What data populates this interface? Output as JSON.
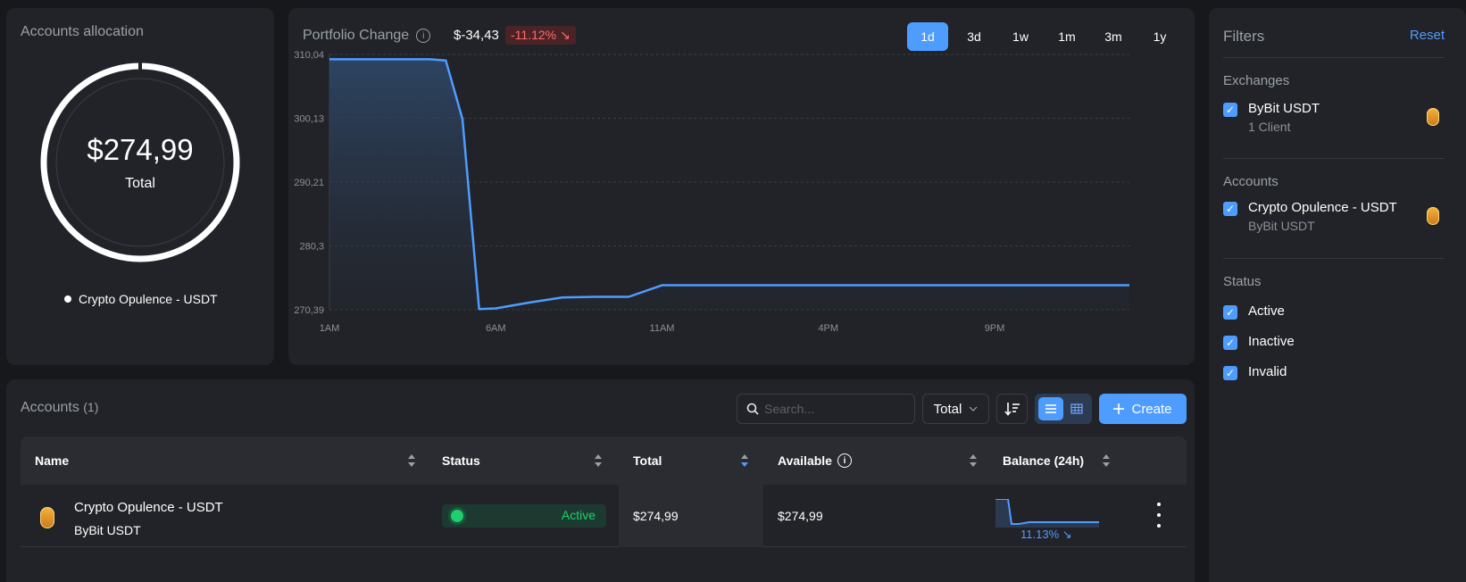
{
  "allocation": {
    "title": "Accounts allocation",
    "total_value": "$274,99",
    "total_label": "Total",
    "legend_item": "Crypto Opulence - USDT"
  },
  "portfolio": {
    "title": "Portfolio Change",
    "change_value": "$-34,43",
    "change_pct": "-11.12%",
    "ranges": [
      "1d",
      "3d",
      "1w",
      "1m",
      "3m",
      "1y"
    ],
    "active_range": "1d"
  },
  "chart_data": {
    "type": "area",
    "title": "",
    "xlabel": "",
    "ylabel": "",
    "y_ticks": [
      "310,04",
      "300,13",
      "290,21",
      "280,3",
      "270,39"
    ],
    "x_ticks": [
      "1AM",
      "6AM",
      "11AM",
      "4PM",
      "9PM"
    ],
    "ylim": [
      270.39,
      310.04
    ],
    "series": [
      {
        "x": [
          "1AM",
          "2AM",
          "3AM",
          "4AM",
          "4:30AM",
          "5AM",
          "5:30AM",
          "6AM",
          "7AM",
          "8AM",
          "9AM",
          "10AM",
          "11AM",
          "1PM",
          "3PM",
          "5PM",
          "7PM",
          "9PM",
          "11PM",
          "12AM"
        ],
        "values": [
          309.3,
          309.3,
          309.3,
          309.3,
          309.1,
          300.0,
          270.5,
          270.6,
          271.5,
          272.3,
          272.4,
          272.4,
          274.2,
          274.2,
          274.2,
          274.2,
          274.2,
          274.2,
          274.2,
          274.2
        ]
      }
    ],
    "grid": true
  },
  "filters": {
    "title": "Filters",
    "reset_label": "Reset",
    "exchanges_label": "Exchanges",
    "exchange_items": [
      {
        "title": "ByBit USDT",
        "subtitle": "1 Client"
      }
    ],
    "accounts_label": "Accounts",
    "account_items": [
      {
        "title": "Crypto Opulence - USDT",
        "subtitle": "ByBit USDT"
      }
    ],
    "status_label": "Status",
    "status_items": [
      "Active",
      "Inactive",
      "Invalid"
    ]
  },
  "accounts": {
    "title": "Accounts",
    "count": "(1)",
    "search_placeholder": "Search...",
    "select_value": "Total",
    "create_label": "Create",
    "columns": [
      "Name",
      "Status",
      "Total",
      "Available",
      "Balance (24h)"
    ],
    "rows": [
      {
        "name": "Crypto Opulence - USDT",
        "exchange": "ByBit USDT",
        "status": "Active",
        "total": "$274,99",
        "available": "$274,99",
        "balance_pct": "11.13%"
      }
    ]
  },
  "colors": {
    "accent": "#4f9cff",
    "positive": "#1ecf6e",
    "negative": "#ff6b6b"
  }
}
